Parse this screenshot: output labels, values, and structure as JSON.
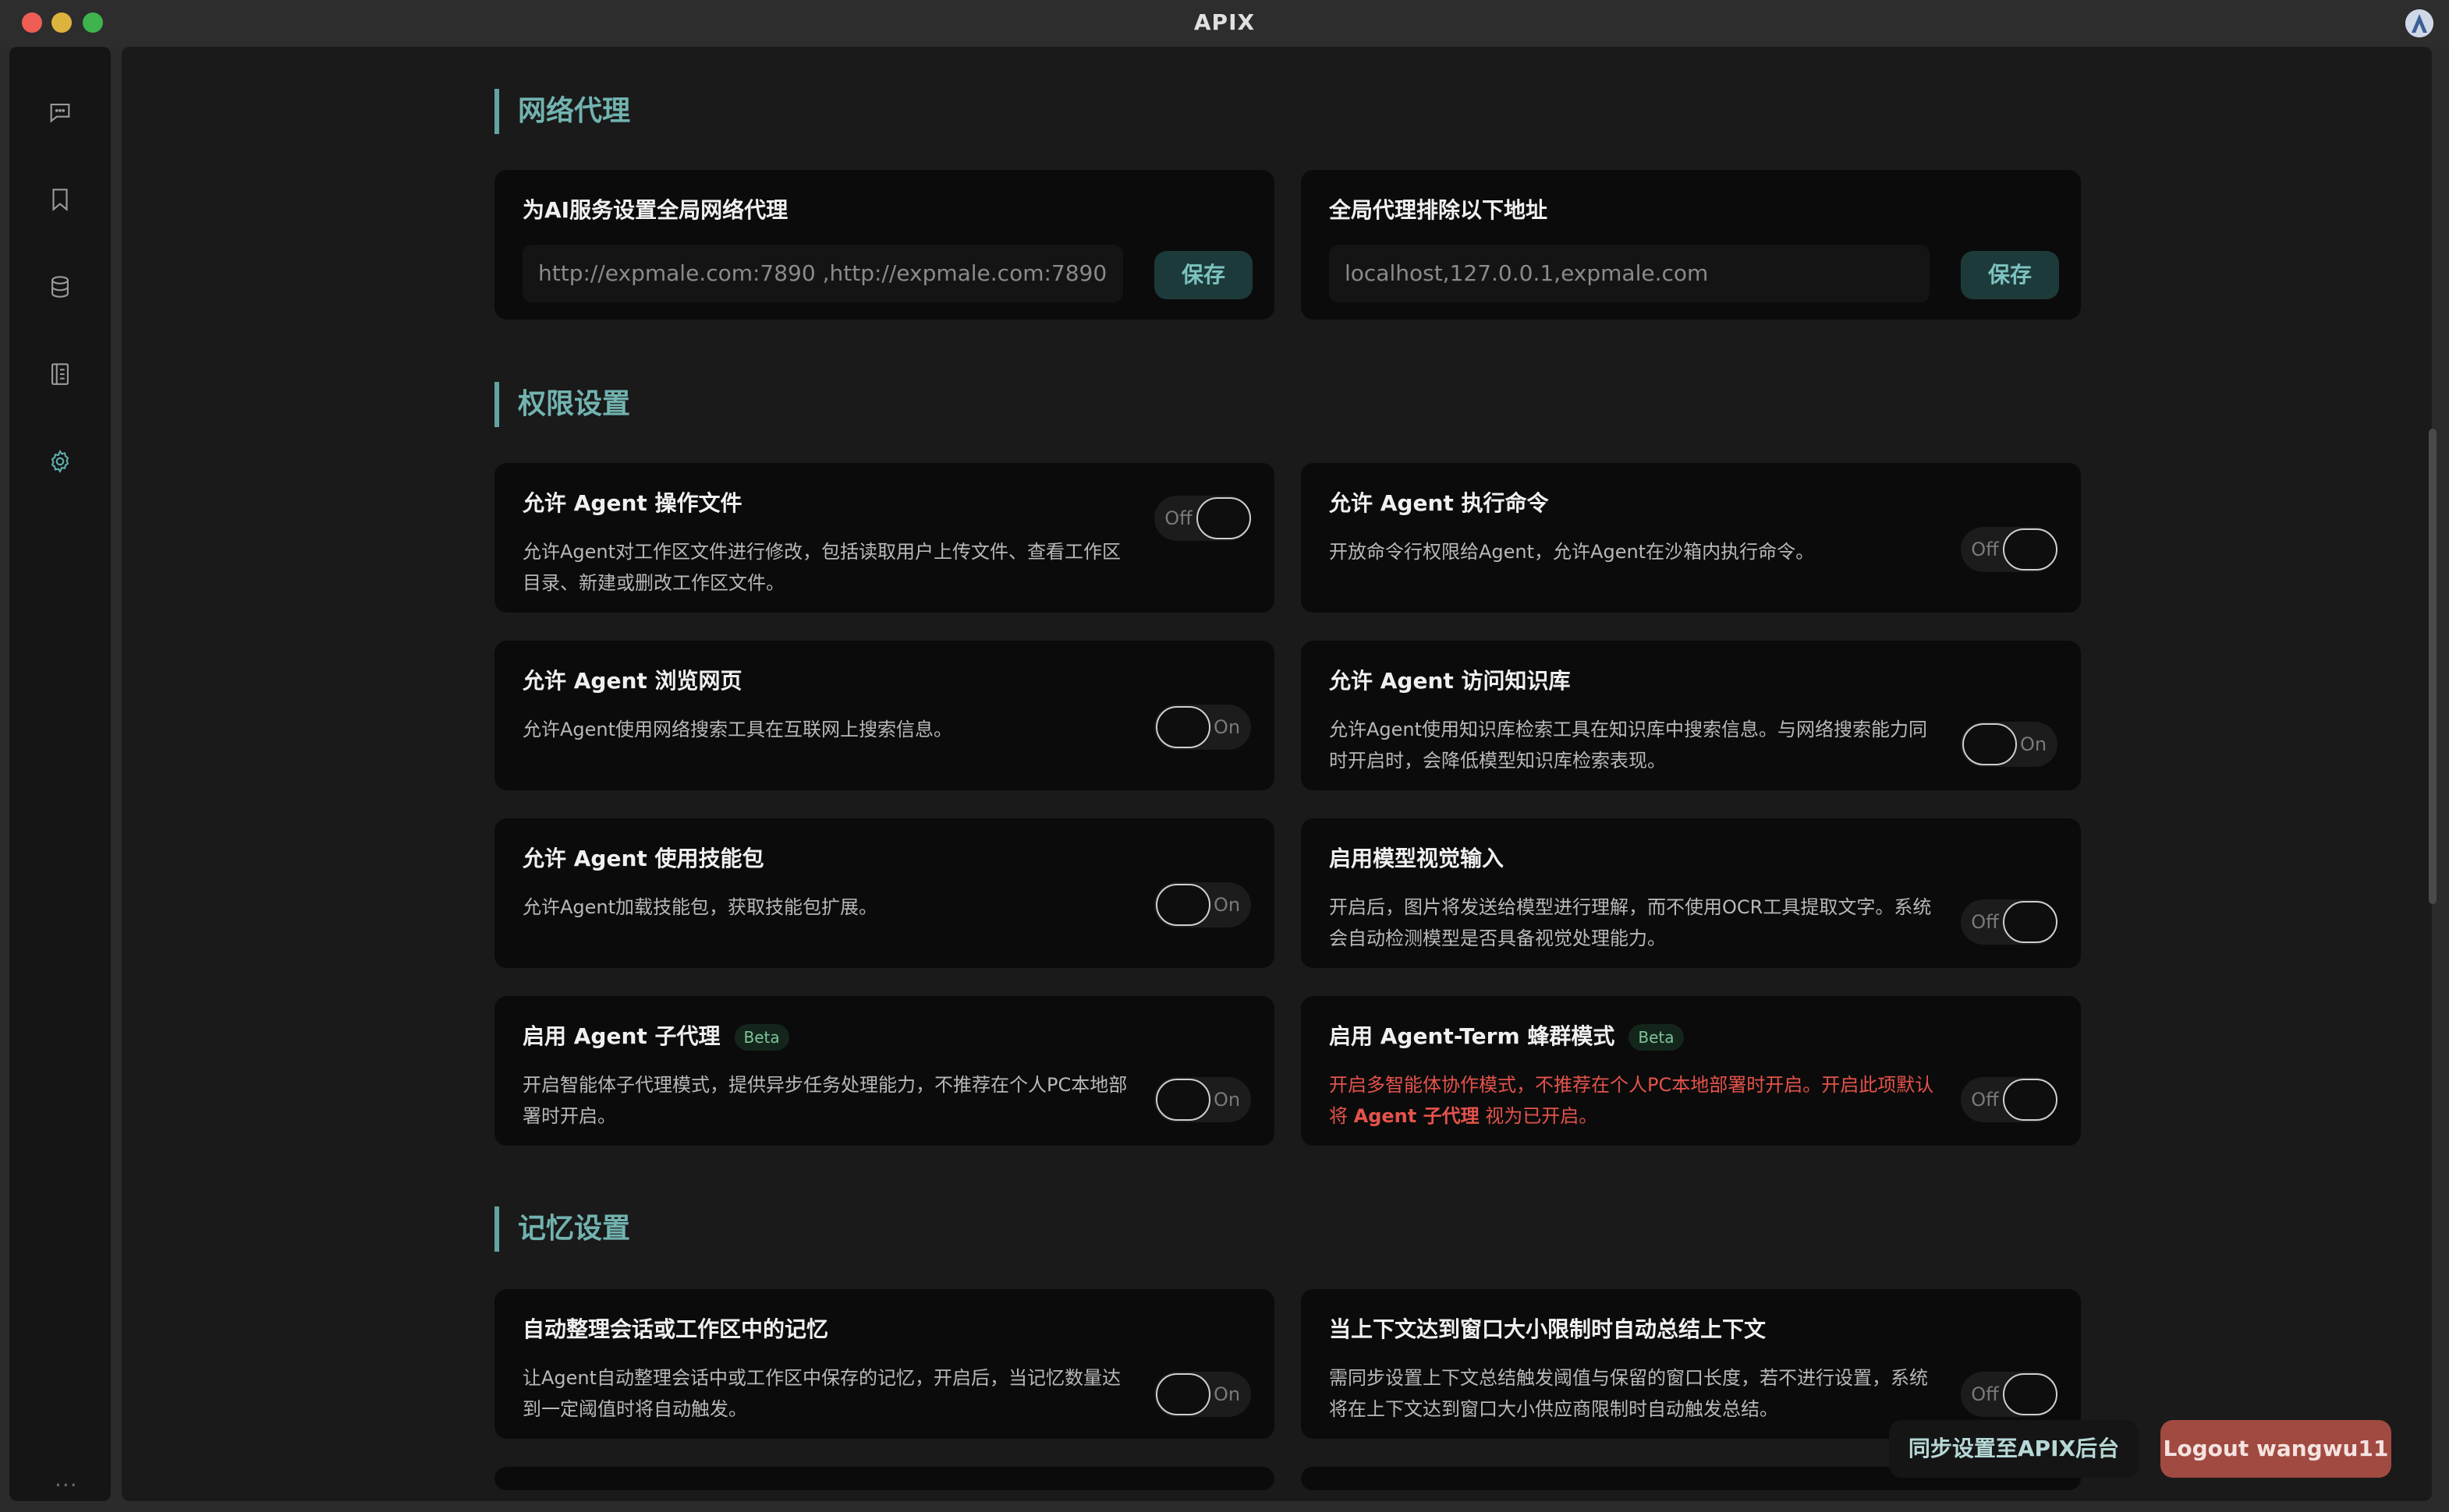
{
  "app": {
    "title": "APIX"
  },
  "sidebar": {
    "items": [
      {
        "icon": "chat-icon"
      },
      {
        "icon": "bookmark-icon"
      },
      {
        "icon": "database-icon"
      },
      {
        "icon": "notebook-icon"
      },
      {
        "icon": "gear-icon",
        "active": true
      }
    ],
    "more": "..."
  },
  "sections": {
    "proxy": {
      "title": "网络代理",
      "global_proxy": {
        "label": "为AI服务设置全局网络代理",
        "value": "http://expmale.com:7890 ,http://expmale.com:7890",
        "save": "保存"
      },
      "proxy_exclude": {
        "label": "全局代理排除以下地址",
        "value": "localhost,127.0.0.1,expmale.com",
        "save": "保存"
      }
    },
    "permissions": {
      "title": "权限设置",
      "items": [
        {
          "title": "允许 Agent 操作文件",
          "desc": "允许Agent对工作区文件进行修改，包括读取用户上传文件、查看工作区目录、新建或删改工作区文件。",
          "state": "on"
        },
        {
          "title": "允许 Agent 执行命令",
          "desc": "开放命令行权限给Agent，允许Agent在沙箱内执行命令。",
          "state": "on"
        },
        {
          "title": "允许 Agent 浏览网页",
          "desc": "允许Agent使用网络搜索工具在互联网上搜索信息。",
          "state": "off"
        },
        {
          "title": "允许 Agent 访问知识库",
          "desc": "允许Agent使用知识库检索工具在知识库中搜索信息。与网络搜索能力同时开启时，会降低模型知识库检索表现。",
          "state": "off"
        },
        {
          "title": "允许 Agent 使用技能包",
          "desc": "允许Agent加载技能包，获取技能包扩展。",
          "state": "off"
        },
        {
          "title": "启用模型视觉输入",
          "desc": "开启后，图片将发送给模型进行理解，而不使用OCR工具提取文字。系统会自动检测模型是否具备视觉处理能力。",
          "state": "on"
        },
        {
          "title": "启用 Agent 子代理",
          "badge": "Beta",
          "desc": "开启智能体子代理模式，提供异步任务处理能力，不推荐在个人PC本地部署时开启。",
          "state": "off"
        },
        {
          "title": "启用 Agent-Term 蜂群模式",
          "badge": "Beta",
          "desc_pre": "开启多智能体协作模式，不推荐在个人PC本地部署时开启。开启此项默认将 ",
          "desc_bold": "Agent 子代理",
          "desc_post": " 视为已开启。",
          "state": "on"
        }
      ]
    },
    "memory": {
      "title": "记忆设置",
      "items": [
        {
          "title": "自动整理会话或工作区中的记忆",
          "desc": "让Agent自动整理会话中或工作区中保存的记忆，开启后，当记忆数量达到一定阈值时将自动触发。",
          "state": "off"
        },
        {
          "title": "当上下文达到窗口大小限制时自动总结上下文",
          "desc": "需同步设置上下文总结触发阈值与保留的窗口长度，若不进行设置，系统将在上下文达到窗口大小供应商限制时自动触发总结。",
          "state": "on"
        }
      ]
    }
  },
  "toggle": {
    "off": "Off",
    "on": "On"
  },
  "footer": {
    "sync": "同步设置至APIX后台",
    "logout": "Logout wangwu11"
  },
  "colors": {
    "accent": "#72b3b0",
    "warn": "#e5534b",
    "logout": "#a14a41"
  }
}
